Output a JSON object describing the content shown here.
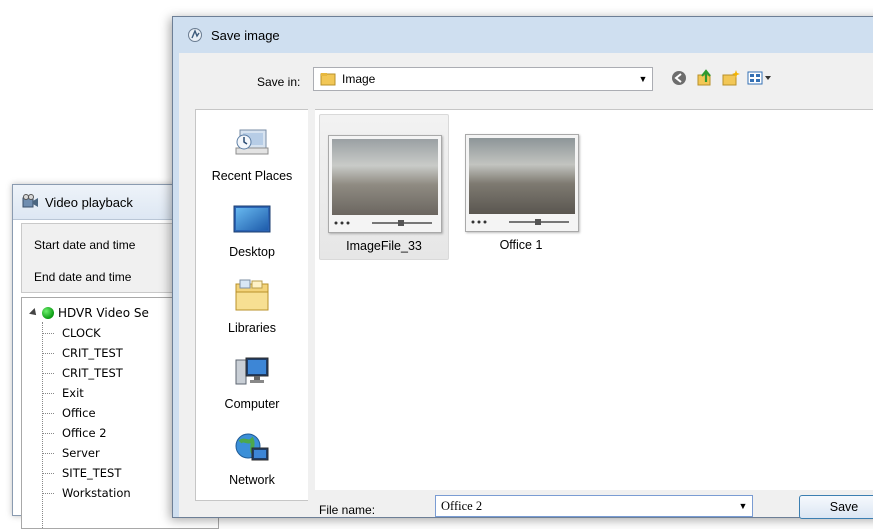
{
  "video_playback": {
    "title": "Video playback",
    "start_label": "Start date and time",
    "end_label": "End date and time",
    "tree_root": "HDVR Video Se",
    "tree_items": [
      "CLOCK",
      "CRIT_TEST",
      "CRIT_TEST",
      "Exit",
      "Office",
      "Office 2",
      "Server",
      "SITE_TEST",
      "Workstation"
    ]
  },
  "save_dialog": {
    "title": "Save image",
    "save_in_label": "Save in:",
    "save_in_value": "Image",
    "toolbar_icons": [
      "back-icon",
      "up-folder-icon",
      "new-folder-icon",
      "view-menu-icon"
    ],
    "places": [
      {
        "label": "Recent Places",
        "icon": "recent-places-icon"
      },
      {
        "label": "Desktop",
        "icon": "desktop-icon"
      },
      {
        "label": "Libraries",
        "icon": "libraries-icon"
      },
      {
        "label": "Computer",
        "icon": "computer-icon"
      },
      {
        "label": "Network",
        "icon": "network-icon"
      }
    ],
    "files": [
      {
        "name": "ImageFile_33",
        "selected": true
      },
      {
        "name": "Office 1",
        "selected": false
      }
    ],
    "file_name_label": "File name:",
    "file_name_value": "Office 2",
    "save_button": "Save"
  }
}
